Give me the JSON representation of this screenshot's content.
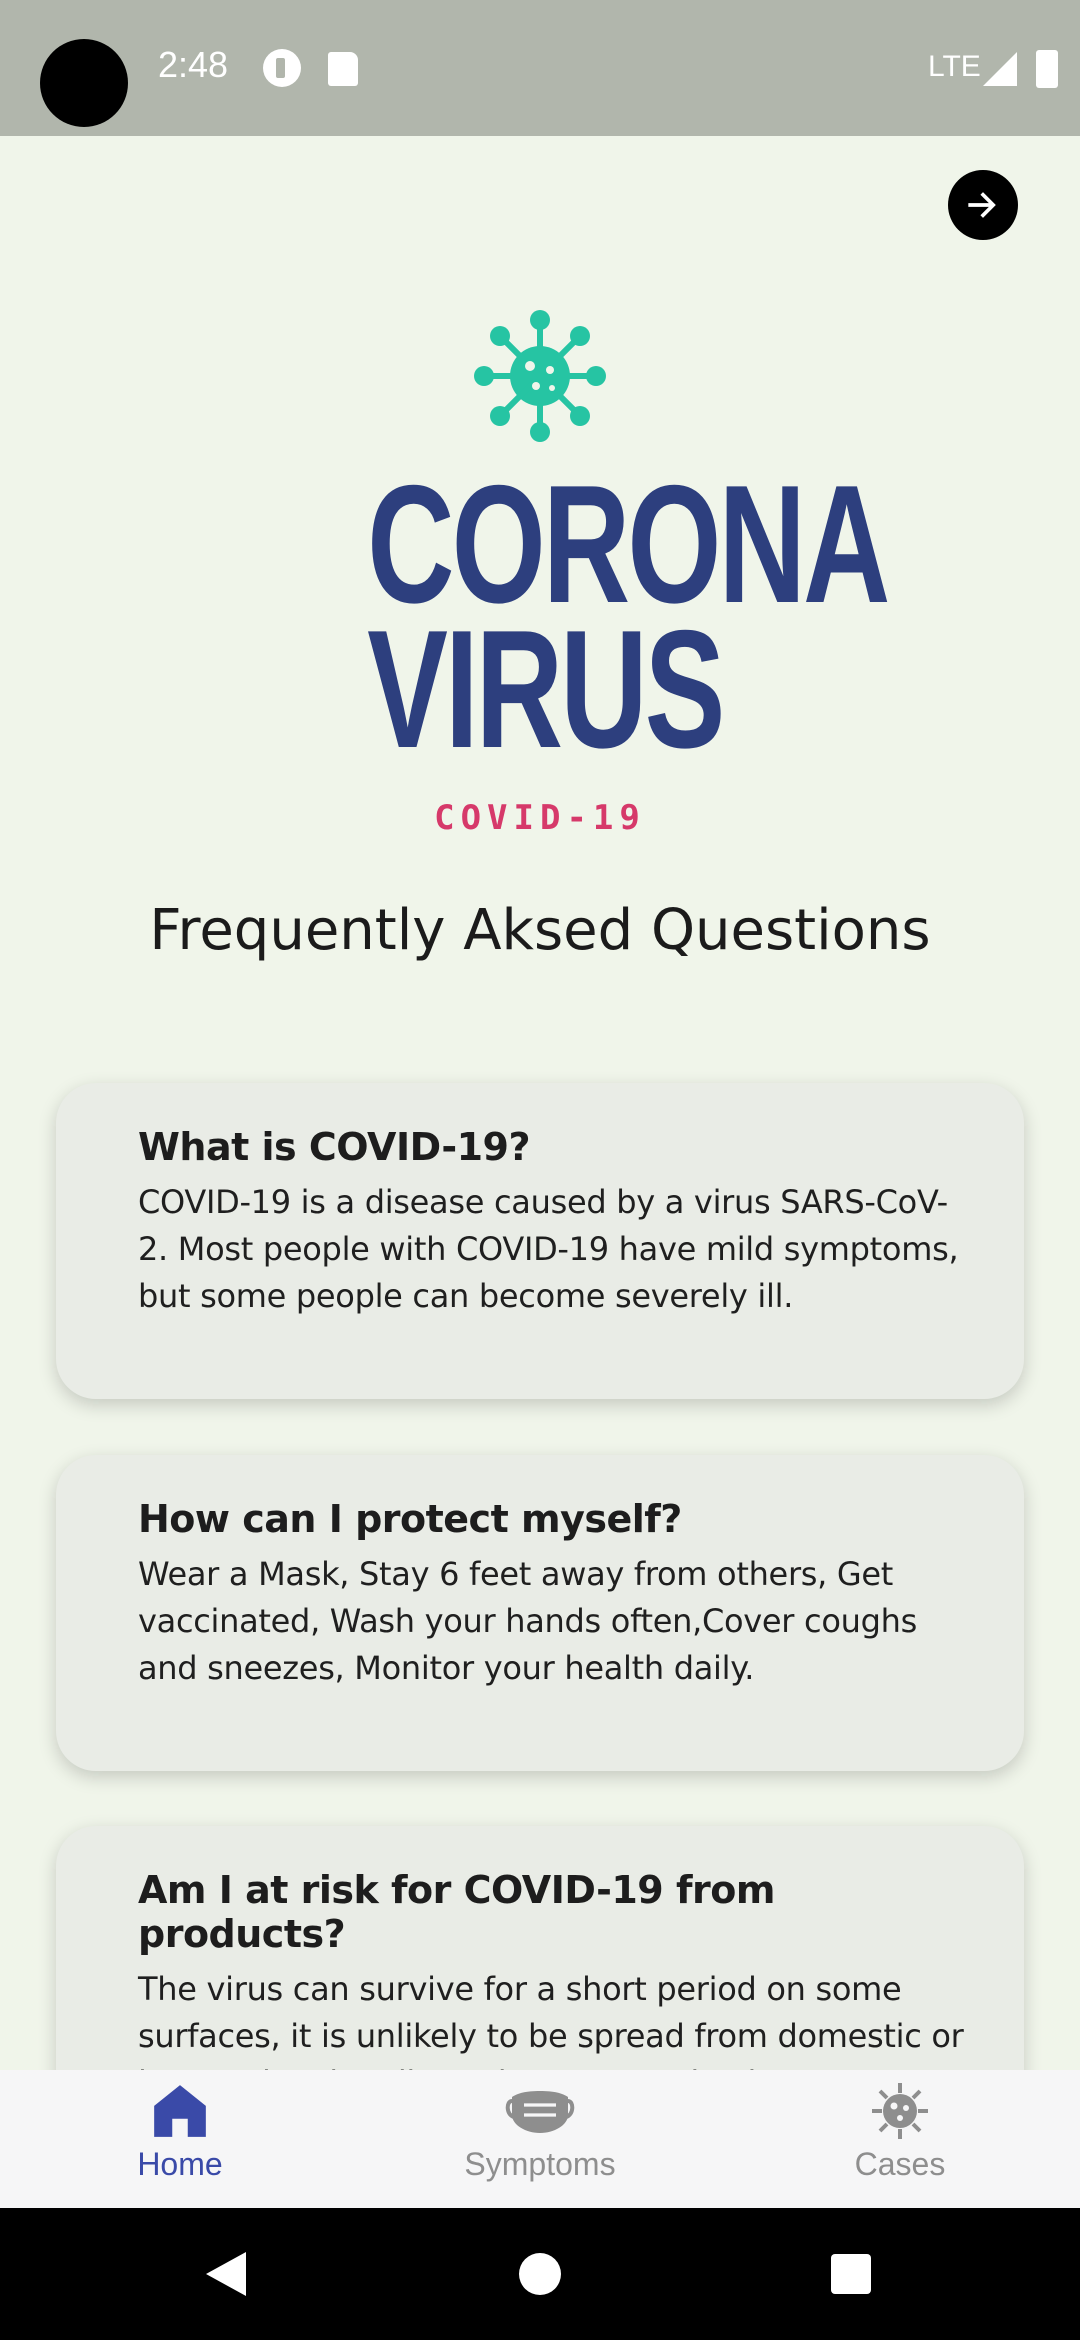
{
  "status_bar": {
    "time": "2:48",
    "network": "LTE"
  },
  "logo": {
    "line1": "CORONA",
    "line2": "VIRUS",
    "subtitle": "COVID-19",
    "colors": {
      "virus": "#26c4a3",
      "title": "#2d3f7e",
      "subtitle": "#d6396a"
    }
  },
  "heading": "Frequently Aksed Questions",
  "faqs": [
    {
      "question": "What is COVID-19?",
      "answer": "COVID-19 is a disease caused by a virus SARS-CoV-2. Most people with COVID-19 have mild symptoms, but some people can become severely ill."
    },
    {
      "question": "How can I protect myself?",
      "answer": "Wear a Mask, Stay 6 feet away from others, Get vaccinated, Wash your hands often,Cover coughs and sneezes, Monitor your health daily."
    },
    {
      "question": "Am I at risk for COVID-19 from products?",
      "answer": "The virus can survive for a short period on some surfaces, it is unlikely to be spread from domestic or international mail, products, or packaging."
    }
  ],
  "bottom_nav": {
    "items": [
      {
        "label": "Home",
        "icon": "home-icon",
        "active": true
      },
      {
        "label": "Symptoms",
        "icon": "mask-icon",
        "active": false
      },
      {
        "label": "Cases",
        "icon": "virus-icon",
        "active": false
      }
    ],
    "active_color": "#3a4aa8",
    "inactive_color": "#8e8e8e"
  }
}
